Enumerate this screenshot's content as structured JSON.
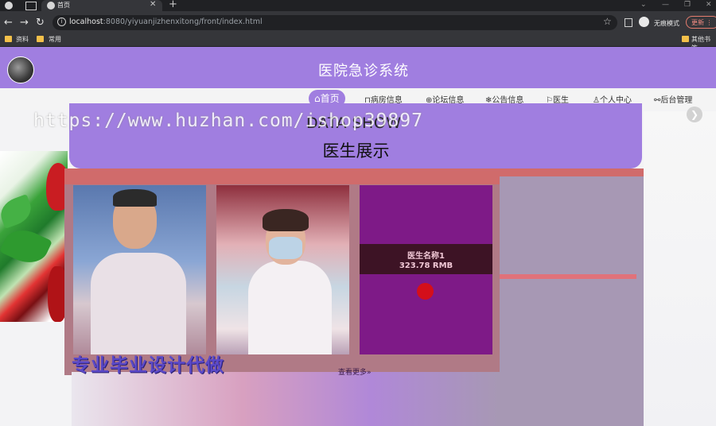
{
  "browser": {
    "tab_title": "首页",
    "url_host": "localhost",
    "url_path": ":8080/yiyuanjizhenxitong/front/index.html",
    "incognito_label": "无痕模式",
    "update_label": "更新",
    "bookmarks": [
      "资料",
      "常用",
      "其他书签"
    ]
  },
  "site": {
    "title": "医院急诊系统",
    "nav": [
      {
        "label": "首页",
        "icon": "home-icon",
        "active": true
      },
      {
        "label": "病房信息",
        "icon": "bed-icon"
      },
      {
        "label": "论坛信息",
        "icon": "chat-icon"
      },
      {
        "label": "公告信息",
        "icon": "notice-icon"
      },
      {
        "label": "医生",
        "icon": "flag-icon"
      },
      {
        "label": "个人中心",
        "icon": "user-icon"
      },
      {
        "label": "后台管理",
        "icon": "link-icon"
      }
    ]
  },
  "section": {
    "title_en": "DATA SHOW",
    "title_zh": "医生展示",
    "more_label": "查看更多"
  },
  "cards": [
    {
      "name": "医生名称1",
      "price": "323.78 RMB"
    }
  ],
  "overlay": {
    "watermark": "https://www.huzhan.com/ishop39897",
    "ad_text": "专业毕业设计代做"
  },
  "colors": {
    "accent": "#a07ee0",
    "browser_dark": "#35363a"
  }
}
